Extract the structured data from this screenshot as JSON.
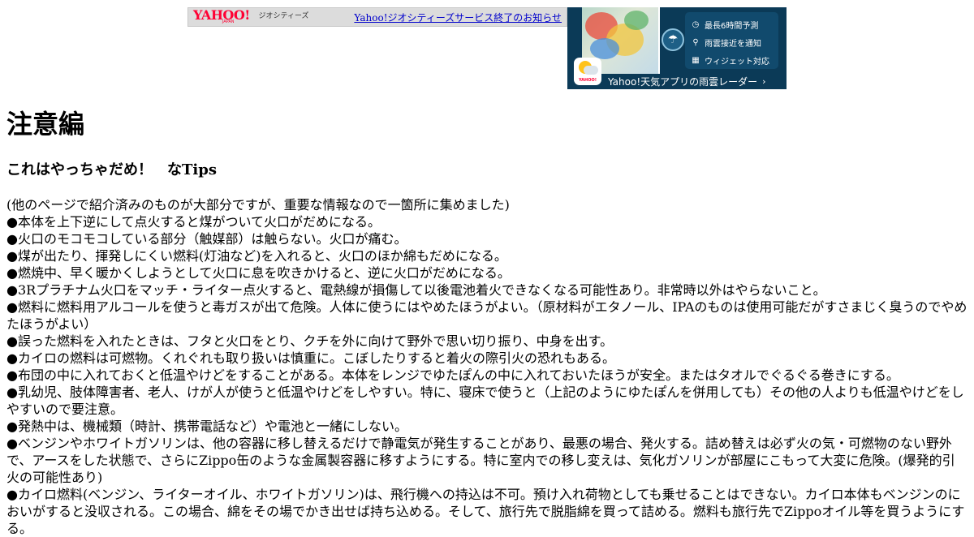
{
  "banner": {
    "logo_text": "YAHOO!",
    "logo_sub": "JAPAN",
    "logo_service": "ジオシティーズ",
    "notice_link": "Yahoo!ジオシティーズサービス終了のお知らせ"
  },
  "ad": {
    "features": [
      {
        "icon": "clock-icon",
        "glyph": "◷",
        "label": "最長6時間予測"
      },
      {
        "icon": "location-pin-icon",
        "glyph": "⚲",
        "label": "雨雲接近を通知"
      },
      {
        "icon": "widget-grid-icon",
        "glyph": "▦",
        "label": "ウィジェット対応"
      }
    ],
    "app_icon_label": "YAHOO!",
    "caption": "Yahoo!天気アプリの雨雲レーダー",
    "caption_arrow": "›"
  },
  "page": {
    "title": "注意編",
    "subtitle": "これはやっちゃだめ！　なTips",
    "lines": [
      "(他のページで紹介済みのものが大部分ですが、重要な情報なので一箇所に集めました)",
      "●本体を上下逆にして点火すると煤がついて火口がだめになる。",
      "●火口のモコモコしている部分（触媒部）は触らない。火口が痛む。",
      "●煤が出たり、揮発しにくい燃料(灯油など)を入れると、火口のほか綿もだめになる。",
      "●燃焼中、早く暖かくしようとして火口に息を吹きかけると、逆に火口がだめになる。",
      "●3Rプラチナム火口をマッチ・ライター点火すると、電熱線が損傷して以後電池着火できなくなる可能性あり。非常時以外はやらないこと。",
      "●燃料に燃料用アルコールを使うと毒ガスが出て危険。人体に使うにはやめたほうがよい。（原材料がエタノール、IPAのものは使用可能だがすさまじく臭うのでやめたほうがよい）",
      "●誤った燃料を入れたときは、フタと火口をとり、クチを外に向けて野外で思い切り振り、中身を出す。",
      "●カイロの燃料は可燃物。くれぐれも取り扱いは慎重に。こぼしたりすると着火の際引火の恐れもある。",
      "●布団の中に入れておくと低温やけどをすることがある。本体をレンジでゆたぽんの中に入れておいたほうが安全。またはタオルでぐるぐる巻きにする。",
      "●乳幼児、肢体障害者、老人、けが人が使うと低温やけどをしやすい。特に、寝床で使うと（上記のようにゆたぽんを併用しても）その他の人よりも低温やけどをしやすいので要注意。",
      "●発熱中は、機械類（時計、携帯電話など）や電池と一緒にしない。",
      "●ベンジンやホワイトガソリンは、他の容器に移し替えるだけで静電気が発生することがあり、最悪の場合、発火する。詰め替えは必ず火の気・可燃物のない野外で、アースをした状態で、さらにZippo缶のような金属製容器に移すようにする。特に室内での移し変えは、気化ガソリンが部屋にこもって大変に危険。(爆発的引火の可能性あり)",
      "●カイロ燃料(ベンジン、ライターオイル、ホワイトガソリン)は、飛行機への持込は不可。預け入れ荷物としても乗せることはできない。カイロ本体もベンジンのにおいがすると没収される。この場合、綿をその場でかき出せば持ち込める。そして、旅行先で脱脂綿を買って詰める。燃料も旅行先でZippoオイル等を買うようにする。"
    ]
  }
}
